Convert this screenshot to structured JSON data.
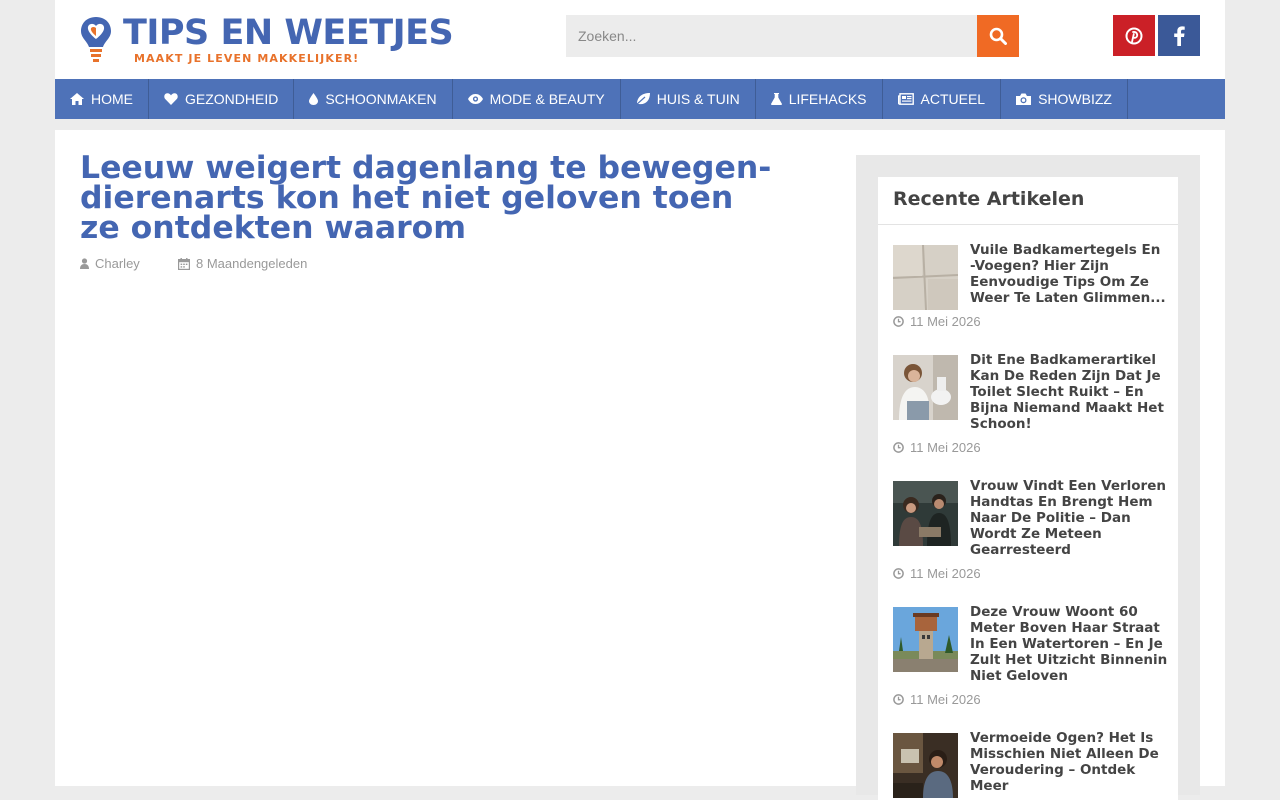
{
  "header": {
    "logo_title": "TIPS EN WEETJES",
    "logo_tagline": "MAAKT JE LEVEN MAKKELIJKER!",
    "search_placeholder": "Zoeken..."
  },
  "colors": {
    "brand_blue": "#4466b2",
    "nav_blue": "#4e72b8",
    "accent_orange": "#f06a24",
    "pinterest_red": "#cb2027",
    "facebook_blue": "#3b5998"
  },
  "social": [
    {
      "name": "pinterest",
      "icon": "pinterest-icon"
    },
    {
      "name": "facebook",
      "icon": "facebook-icon"
    }
  ],
  "nav": [
    {
      "label": "HOME",
      "icon": "home-icon"
    },
    {
      "label": "GEZONDHEID",
      "icon": "heart-icon"
    },
    {
      "label": "SCHOONMAKEN",
      "icon": "drop-icon"
    },
    {
      "label": "MODE & BEAUTY",
      "icon": "eye-icon"
    },
    {
      "label": "HUIS & TUIN",
      "icon": "leaf-icon"
    },
    {
      "label": "LIFEHACKS",
      "icon": "flask-icon"
    },
    {
      "label": "ACTUEEL",
      "icon": "newspaper-icon"
    },
    {
      "label": "SHOWBIZZ",
      "icon": "camera-icon"
    }
  ],
  "article": {
    "title": "Leeuw weigert dagenlang te bewegen- dierenarts kon het niet geloven toen ze ontdekten waarom",
    "author": "Charley",
    "date": "8 Maandengeleden"
  },
  "sidebar": {
    "widget_title": "Recente Artikelen",
    "posts": [
      {
        "title": "Vuile Badkamertegels En -Voegen? Hier Zijn Eenvoudige Tips Om Ze Weer Te Laten Glimmen...",
        "date": "11 Mei 2026"
      },
      {
        "title": "Dit Ene Badkamerartikel Kan De Reden Zijn Dat Je Toilet Slecht Ruikt – En Bijna Niemand Maakt Het Schoon!",
        "date": "11 Mei 2026"
      },
      {
        "title": "Vrouw Vindt Een Verloren Handtas En Brengt Hem Naar De Politie – Dan Wordt Ze Meteen Gearresteerd",
        "date": "11 Mei 2026"
      },
      {
        "title": "Deze Vrouw Woont 60 Meter Boven Haar Straat In Een Watertoren – En Je Zult Het Uitzicht Binnenin Niet Geloven",
        "date": "11 Mei 2026"
      },
      {
        "title": "Vermoeide Ogen? Het Is Misschien Niet Alleen De Veroudering – Ontdek Meer",
        "date": ""
      }
    ]
  }
}
